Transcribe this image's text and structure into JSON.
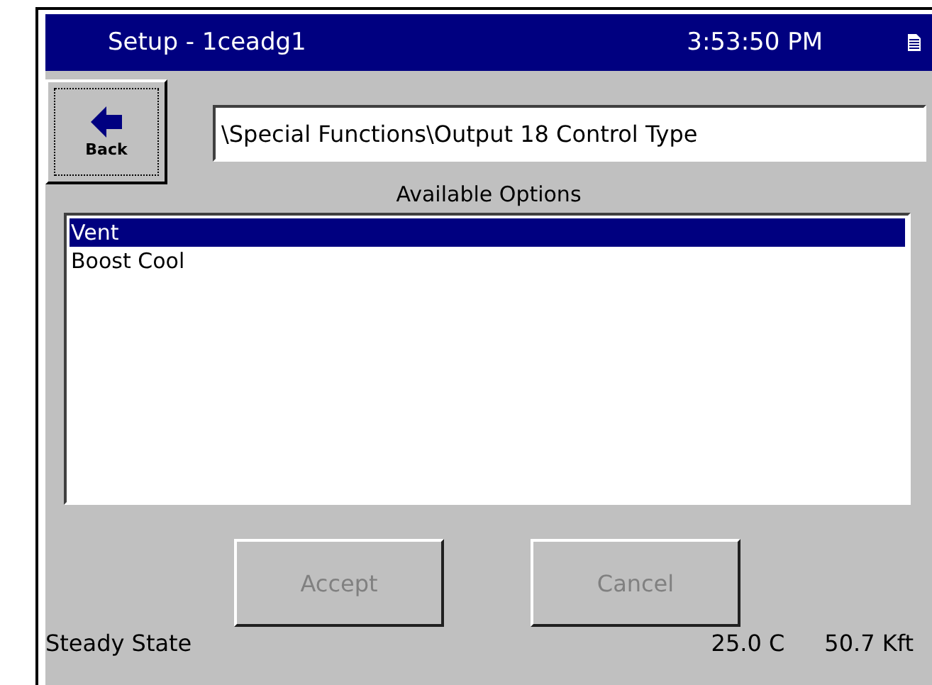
{
  "window": {
    "title": "Setup - 1ceadg1",
    "time": "3:53:50 PM"
  },
  "back_button": {
    "label": "Back"
  },
  "path": {
    "value": "\\Special Functions\\Output 18 Control Type"
  },
  "options": {
    "heading": "Available Options",
    "items": [
      {
        "label": "Vent",
        "selected": true
      },
      {
        "label": "Boost Cool",
        "selected": false
      }
    ]
  },
  "buttons": [
    {
      "label": "Accept",
      "disabled": true
    },
    {
      "label": "Cancel",
      "disabled": true
    }
  ],
  "status_bar": {
    "state": "Steady State",
    "temperature": "25.0 C",
    "altitude": "50.7 Kft"
  }
}
